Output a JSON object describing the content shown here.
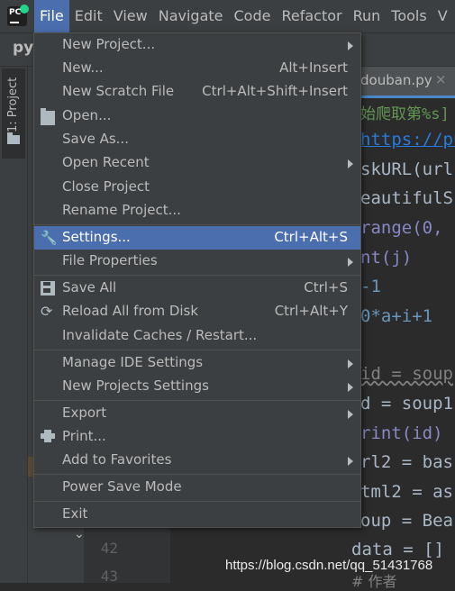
{
  "menubar": {
    "items": [
      "File",
      "Edit",
      "View",
      "Navigate",
      "Code",
      "Refactor",
      "Run",
      "Tools",
      "V"
    ]
  },
  "titlestrip": {
    "project": "py"
  },
  "toolwindow": {
    "project_tab": "1: Project"
  },
  "editor": {
    "tab_name": "douban.py",
    "tab_close": "×",
    "line_numbers": [
      "42",
      "43"
    ],
    "code": {
      "l1": "始爬取第%s]",
      "l2": "https://pu",
      "l3_a": "skURL(url",
      "l4_a": "eautifulS",
      "l5_a": "range(0, ",
      "l6_a": "nt(j)",
      "l7_a": "-1",
      "l8_a": "0*a+i+1",
      "l9_a": "id = soup",
      "l10_a": "d = soup1",
      "l11_a": "rint(id)",
      "l12_a": "rl2 = bas",
      "l13_a": "tml2 = as",
      "l14_a": "oup = Bea",
      "l15_a": "data = []",
      "l16_a": "# 作者"
    }
  },
  "file_menu": {
    "new_project": "New Project...",
    "new": "New...",
    "new_shortcut": "Alt+Insert",
    "new_scratch": "New Scratch File",
    "new_scratch_shortcut": "Ctrl+Alt+Shift+Insert",
    "open": "Open...",
    "save_as": "Save As...",
    "open_recent": "Open Recent",
    "close_project": "Close Project",
    "rename_project": "Rename Project...",
    "settings": "Settings...",
    "settings_shortcut": "Ctrl+Alt+S",
    "file_properties": "File Properties",
    "save_all": "Save All",
    "save_all_shortcut": "Ctrl+S",
    "reload": "Reload All from Disk",
    "reload_shortcut": "Ctrl+Alt+Y",
    "invalidate": "Invalidate Caches / Restart...",
    "manage_ide": "Manage IDE Settings",
    "new_projects_settings": "New Projects Settings",
    "export": "Export",
    "print": "Print...",
    "add_favorites": "Add to Favorites",
    "power_save": "Power Save Mode",
    "exit": "Exit"
  },
  "watermark": "https://blog.csdn.net/qq_51431768",
  "colors": {
    "accent": "#4b6eaf",
    "menu_bg": "#3c3f41",
    "editor_bg": "#2b2b2b"
  },
  "icons": [
    "pycharm-logo-icon",
    "wrench-icon",
    "folder-open-icon",
    "save-icon",
    "reload-icon",
    "printer-icon",
    "folder-icon",
    "chevron-down-icon"
  ]
}
